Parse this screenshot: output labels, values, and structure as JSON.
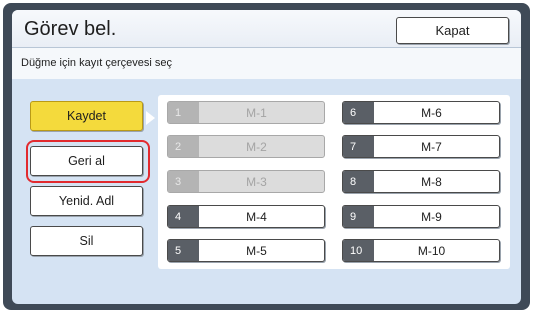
{
  "dialog": {
    "title": "Görev bel.",
    "close_label": "Kapat",
    "subtitle": "Düğme için kayıt çerçevesi seç"
  },
  "side_buttons": [
    {
      "label": "Kaydet",
      "active": true
    },
    {
      "label": "Geri al",
      "highlighted": true
    },
    {
      "label": "Yenid. Adl"
    },
    {
      "label": "Sil"
    }
  ],
  "slots": [
    {
      "num": "1",
      "label": "M-1",
      "enabled": false
    },
    {
      "num": "2",
      "label": "M-2",
      "enabled": false
    },
    {
      "num": "3",
      "label": "M-3",
      "enabled": false
    },
    {
      "num": "4",
      "label": "M-4",
      "enabled": true
    },
    {
      "num": "5",
      "label": "M-5",
      "enabled": true
    },
    {
      "num": "6",
      "label": "M-6",
      "enabled": true
    },
    {
      "num": "7",
      "label": "M-7",
      "enabled": true
    },
    {
      "num": "8",
      "label": "M-8",
      "enabled": true
    },
    {
      "num": "9",
      "label": "M-9",
      "enabled": true
    },
    {
      "num": "10",
      "label": "M-10",
      "enabled": true
    }
  ],
  "colors": {
    "active_button": "#f4da3c",
    "highlight": "#e22a2f",
    "panel_background": "#d5e3f3"
  }
}
